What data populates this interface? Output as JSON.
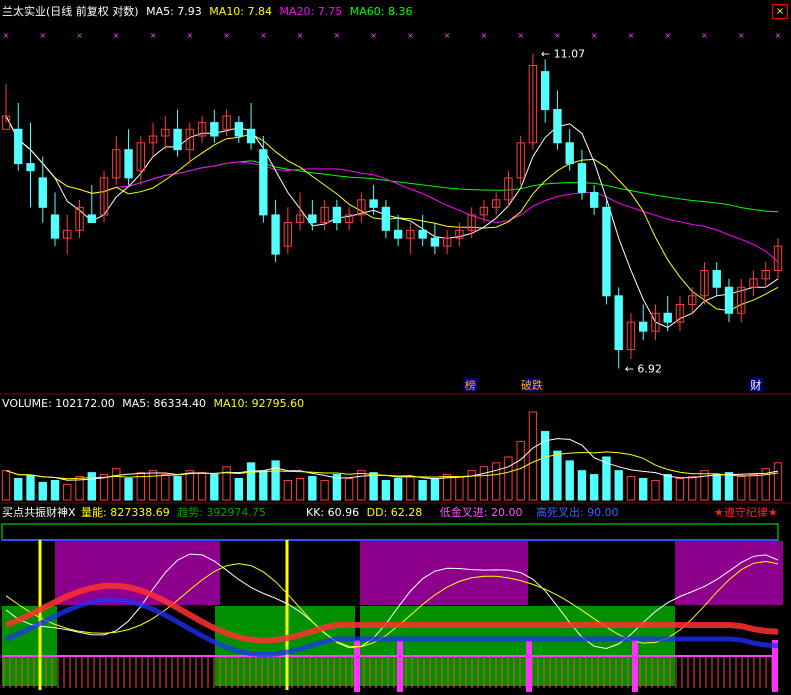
{
  "header": {
    "title": "兰太实业(日线 前复权 对数)",
    "ma5": "MA5: 7.93",
    "ma10": "MA10: 7.84",
    "ma20": "MA20: 7.75",
    "ma60": "MA60: 8.36"
  },
  "volume_header": {
    "volume": "VOLUME: 102172.00",
    "ma5": "MA5: 86334.40",
    "ma10": "MA10: 92795.60"
  },
  "indicator_header": {
    "name": "买点共振财神X",
    "liangneng": "量能: 827338.69",
    "qushi": "趋势: 392974.75",
    "kk": "KK: 60.96",
    "dd": "DD: 62.28",
    "dijin": "低金叉进: 20.00",
    "gaosi": "高死叉出: 90.00",
    "zunshou": "★遵守纪律★"
  },
  "colors": {
    "bg": "#000000",
    "up": "#ff3c3c",
    "down": "#54ffff",
    "ma5": "#ffffff",
    "ma10": "#ffff00",
    "ma20": "#ff00ff",
    "ma60": "#00ff00",
    "purple_zone": "#9b009b",
    "green_zone": "#00a000"
  },
  "chart_data": [
    {
      "type": "candlestick",
      "title": "兰太实业(日线 前复权 对数)",
      "ylim": [
        6.7,
        11.5
      ],
      "annotations": {
        "high": "11.07",
        "low": "6.92",
        "tags": [
          "榜",
          "破跌",
          "财"
        ]
      },
      "candles": [
        [
          9.9,
          10.6,
          10.0,
          10.1
        ],
        [
          9.9,
          10.3,
          9.3,
          9.4
        ],
        [
          9.4,
          10.0,
          8.8,
          9.3
        ],
        [
          9.2,
          9.5,
          8.6,
          8.8
        ],
        [
          8.7,
          9.0,
          8.3,
          8.4
        ],
        [
          8.4,
          8.7,
          8.2,
          8.5
        ],
        [
          8.5,
          8.9,
          8.4,
          8.8
        ],
        [
          8.7,
          9.1,
          8.6,
          8.6
        ],
        [
          8.7,
          9.3,
          8.6,
          9.2
        ],
        [
          9.2,
          9.8,
          9.1,
          9.6
        ],
        [
          9.6,
          9.9,
          9.1,
          9.2
        ],
        [
          9.3,
          9.8,
          9.1,
          9.7
        ],
        [
          9.7,
          10.0,
          9.5,
          9.8
        ],
        [
          9.8,
          10.1,
          9.6,
          9.9
        ],
        [
          9.9,
          10.2,
          9.5,
          9.6
        ],
        [
          9.6,
          10.0,
          9.4,
          9.9
        ],
        [
          9.8,
          10.1,
          9.7,
          10.0
        ],
        [
          10.0,
          10.2,
          9.7,
          9.8
        ],
        [
          9.9,
          10.2,
          9.8,
          10.1
        ],
        [
          10.0,
          10.1,
          9.7,
          9.8
        ],
        [
          9.9,
          10.3,
          9.6,
          9.7
        ],
        [
          9.6,
          9.8,
          8.6,
          8.7
        ],
        [
          8.7,
          8.9,
          8.1,
          8.2
        ],
        [
          8.3,
          8.8,
          8.2,
          8.6
        ],
        [
          8.6,
          9.0,
          8.5,
          8.7
        ],
        [
          8.7,
          8.9,
          8.5,
          8.6
        ],
        [
          8.6,
          8.9,
          8.5,
          8.8
        ],
        [
          8.8,
          8.9,
          8.5,
          8.6
        ],
        [
          8.6,
          8.8,
          8.5,
          8.7
        ],
        [
          8.7,
          9.0,
          8.6,
          8.9
        ],
        [
          8.9,
          9.1,
          8.7,
          8.8
        ],
        [
          8.8,
          8.9,
          8.4,
          8.5
        ],
        [
          8.5,
          8.7,
          8.3,
          8.4
        ],
        [
          8.4,
          8.6,
          8.2,
          8.5
        ],
        [
          8.5,
          8.7,
          8.3,
          8.4
        ],
        [
          8.4,
          8.6,
          8.2,
          8.3
        ],
        [
          8.3,
          8.5,
          8.2,
          8.4
        ],
        [
          8.4,
          8.6,
          8.3,
          8.5
        ],
        [
          8.5,
          8.8,
          8.4,
          8.7
        ],
        [
          8.7,
          8.9,
          8.6,
          8.8
        ],
        [
          8.8,
          9.0,
          8.7,
          8.9
        ],
        [
          8.9,
          9.3,
          8.8,
          9.2
        ],
        [
          9.2,
          9.8,
          9.1,
          9.7
        ],
        [
          9.7,
          11.1,
          9.6,
          10.9
        ],
        [
          10.8,
          11.0,
          10.0,
          10.2
        ],
        [
          10.2,
          10.5,
          9.6,
          9.7
        ],
        [
          9.7,
          9.9,
          9.3,
          9.4
        ],
        [
          9.4,
          9.6,
          8.9,
          9.0
        ],
        [
          9.0,
          9.1,
          8.7,
          8.8
        ],
        [
          8.8,
          8.9,
          7.6,
          7.7
        ],
        [
          7.7,
          7.8,
          6.9,
          7.1
        ],
        [
          7.1,
          7.5,
          7.0,
          7.4
        ],
        [
          7.4,
          7.6,
          7.2,
          7.3
        ],
        [
          7.3,
          7.6,
          7.2,
          7.5
        ],
        [
          7.5,
          7.7,
          7.3,
          7.4
        ],
        [
          7.4,
          7.7,
          7.3,
          7.6
        ],
        [
          7.6,
          7.8,
          7.5,
          7.7
        ],
        [
          7.7,
          8.1,
          7.6,
          8.0
        ],
        [
          8.0,
          8.1,
          7.7,
          7.8
        ],
        [
          7.8,
          7.9,
          7.4,
          7.5
        ],
        [
          7.5,
          7.9,
          7.4,
          7.8
        ],
        [
          7.8,
          8.0,
          7.7,
          7.9
        ],
        [
          7.9,
          8.1,
          7.8,
          8.0
        ],
        [
          8.0,
          8.4,
          7.9,
          8.3
        ]
      ]
    },
    {
      "type": "bar",
      "title": "VOLUME",
      "values": [
        30,
        22,
        25,
        18,
        20,
        16,
        24,
        28,
        26,
        32,
        22,
        28,
        30,
        26,
        24,
        30,
        28,
        26,
        34,
        22,
        38,
        30,
        40,
        20,
        22,
        24,
        20,
        26,
        22,
        30,
        28,
        20,
        22,
        24,
        20,
        22,
        26,
        24,
        30,
        34,
        38,
        44,
        60,
        90,
        70,
        50,
        40,
        30,
        26,
        44,
        30,
        24,
        22,
        20,
        26,
        22,
        24,
        30,
        26,
        28,
        24,
        26,
        32,
        38
      ]
    }
  ]
}
